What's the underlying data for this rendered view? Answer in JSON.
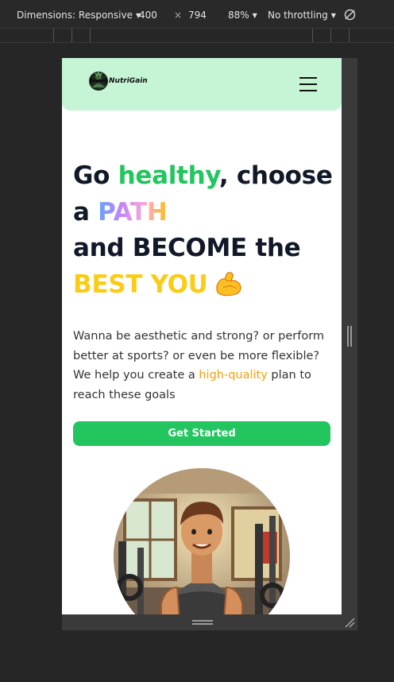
{
  "devtools": {
    "dimensions_label": "Dimensions: Responsive",
    "width": "400",
    "times": "×",
    "height": "794",
    "zoom": "88%",
    "throttling": "No throttling"
  },
  "site": {
    "brand": "NutriGain",
    "hero": {
      "line1_a": "Go ",
      "line1_b": "healthy",
      "line1_c": ", choose",
      "line2_a": "a ",
      "line2_b": "PATH",
      "line3": "and BECOME the",
      "line4": "BEST YOU",
      "body_a": "Wanna be aesthetic and strong? or perform better at sports? or even be more flexible? We help you create a ",
      "body_highlight": "high-quality",
      "body_b": " plan to reach these goals",
      "cta": "Get Started"
    }
  },
  "colors": {
    "header_bg": "#c5f5d5",
    "accent_green": "#22c55e",
    "accent_yellow": "#facc15",
    "accent_orange": "#f59e0b",
    "text_dark": "#111827"
  }
}
